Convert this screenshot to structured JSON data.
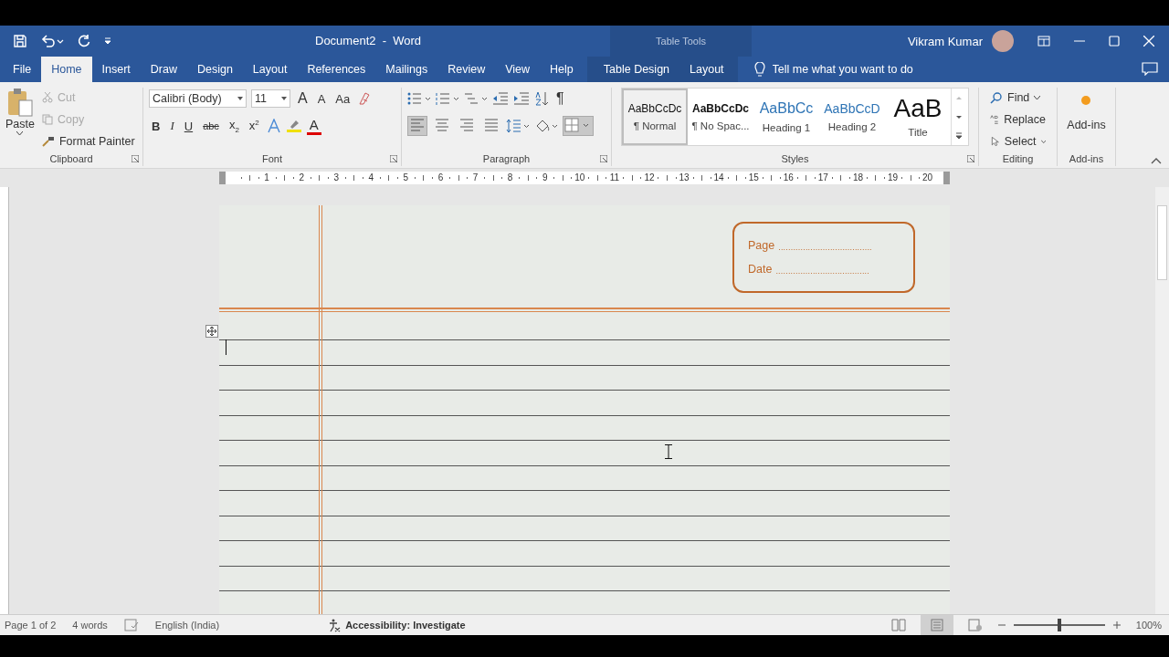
{
  "window": {
    "title": "Document2  -  Word",
    "context_title": "Table Tools",
    "user": "Vikram Kumar"
  },
  "tabs": [
    {
      "label": "File",
      "selected": false
    },
    {
      "label": "Home",
      "selected": true
    },
    {
      "label": "Insert",
      "selected": false
    },
    {
      "label": "Draw",
      "selected": false
    },
    {
      "label": "Design",
      "selected": false
    },
    {
      "label": "Layout",
      "selected": false
    },
    {
      "label": "References",
      "selected": false
    },
    {
      "label": "Mailings",
      "selected": false
    },
    {
      "label": "Review",
      "selected": false
    },
    {
      "label": "View",
      "selected": false
    },
    {
      "label": "Help",
      "selected": false
    }
  ],
  "context_tabs": [
    {
      "label": "Table Design",
      "selected": false
    },
    {
      "label": "Layout",
      "selected": false
    }
  ],
  "search": {
    "placeholder": "Tell me what you want to do"
  },
  "clipboard": {
    "label": "Clipboard",
    "paste": "Paste",
    "items": [
      {
        "label": "Cut",
        "disabled": true
      },
      {
        "label": "Copy",
        "disabled": true
      },
      {
        "label": "Format Painter",
        "disabled": false
      }
    ]
  },
  "font": {
    "label": "Font",
    "name": "Calibri (Body)",
    "size": "11",
    "grow": "A",
    "shrink": "A",
    "case": "Aa",
    "buttons": [
      {
        "kind": "bold",
        "label": "B"
      },
      {
        "kind": "italic",
        "label": "I"
      },
      {
        "kind": "underline",
        "label": "U"
      },
      {
        "kind": "strike",
        "label": "abc"
      },
      {
        "kind": "sub",
        "label": "x",
        "mark": "2"
      },
      {
        "kind": "sup",
        "label": "x",
        "mark": "2"
      }
    ],
    "color_label": "A"
  },
  "paragraph": {
    "label": "Paragraph",
    "pilcrow": "¶",
    "align": [
      {
        "selected": true
      },
      {
        "selected": false
      },
      {
        "selected": false
      },
      {
        "selected": false
      }
    ]
  },
  "styles": {
    "label": "Styles",
    "items": [
      {
        "preview": "AaBbCcDc",
        "name": "¶ Normal",
        "kind": "normal",
        "selected": true
      },
      {
        "preview": "AaBbCcDc",
        "name": "¶ No Spac...",
        "kind": "strong",
        "selected": false
      },
      {
        "preview": "AaBbCc",
        "name": "Heading 1",
        "kind": "h1",
        "selected": false
      },
      {
        "preview": "AaBbCcD",
        "name": "Heading 2",
        "kind": "h2",
        "selected": false
      },
      {
        "preview": "AaB",
        "name": "Title",
        "kind": "title",
        "selected": false
      }
    ]
  },
  "editing": {
    "label": "Editing",
    "items": [
      {
        "kind": "find",
        "label": "Find"
      },
      {
        "kind": "replace",
        "label": "Replace"
      },
      {
        "kind": "select",
        "label": "Select"
      }
    ]
  },
  "addins": {
    "button": "Add-ins",
    "label": "Add-ins"
  },
  "ruler": [
    "1",
    "2",
    "3",
    "4",
    "5",
    "6",
    "7",
    "8",
    "9",
    "10",
    "11",
    "12",
    "13",
    "14",
    "15",
    "16",
    "17",
    "18",
    "19",
    "20"
  ],
  "document": {
    "fields": [
      {
        "label": "Page",
        "dots": "......................................"
      },
      {
        "label": "Date",
        "dots": "......................................"
      }
    ]
  },
  "status_bar": {
    "page": "Page 1 of 2",
    "words": "4 words",
    "language": "English (India)",
    "accessibility": "**Accessibility:** **Investigate**",
    "views": [
      {
        "kind": "read",
        "selected": false
      },
      {
        "kind": "print",
        "selected": true
      },
      {
        "kind": "web",
        "selected": false
      }
    ],
    "zoom": {
      "level": 0.5
    },
    "zoom_text": "100%"
  }
}
